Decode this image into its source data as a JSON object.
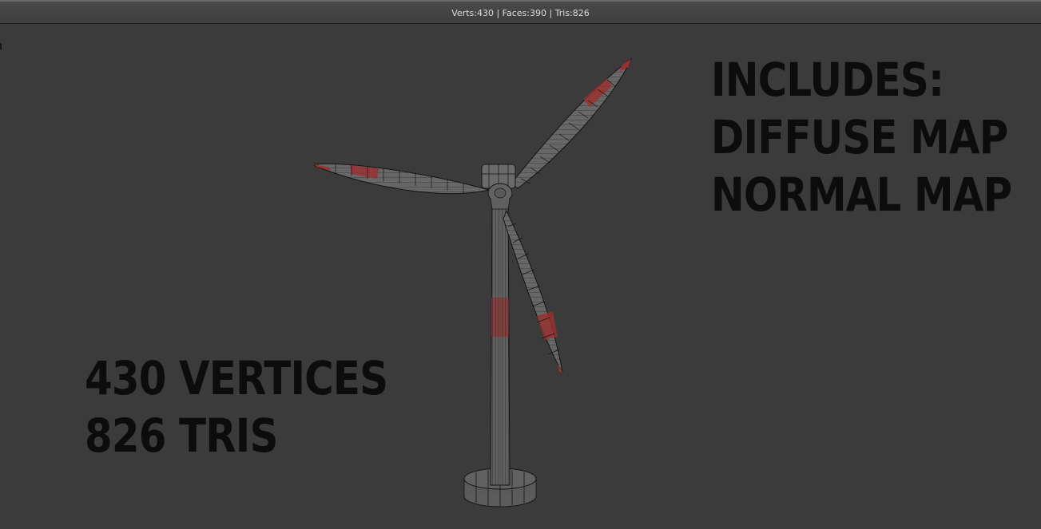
{
  "header": {
    "stats": "Verts:430 | Faces:390 | Tris:826"
  },
  "overlay": {
    "includes_lines": [
      "INCLUDES:",
      "DIFFUSE MAP",
      "NORMAL MAP"
    ],
    "stats_lines": [
      "430 VERTICES",
      "826 TRIS"
    ]
  },
  "colors": {
    "background": "#3b3b3b",
    "mesh_fill": "#626262",
    "wire": "#141414",
    "accent_red": "#8c2c2c",
    "text": "#0c0c0c"
  },
  "model": {
    "name": "wind-turbine"
  }
}
